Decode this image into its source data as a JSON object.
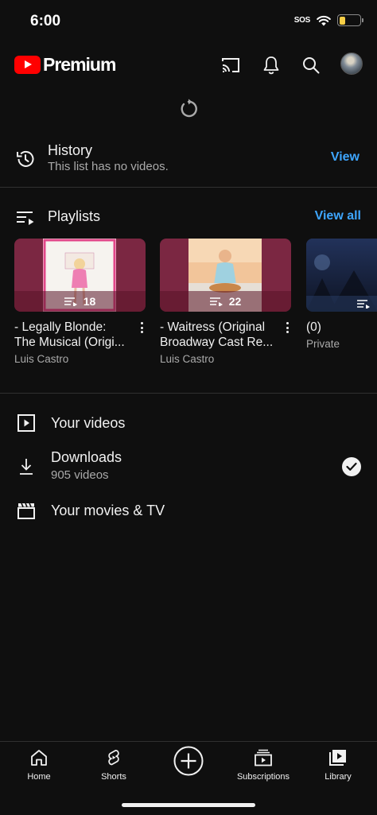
{
  "status_bar": {
    "time": "6:00",
    "sos": "SOS",
    "battery_level": 0.3
  },
  "app_bar": {
    "logo_text": "Premium",
    "icons": [
      "cast-icon",
      "bell-icon",
      "search-icon",
      "avatar"
    ]
  },
  "history": {
    "title": "History",
    "subtitle": "This list has no videos.",
    "action": "View"
  },
  "playlists": {
    "title": "Playlists",
    "action": "View all",
    "items": [
      {
        "line1": "- Legally Blonde:",
        "line2": "The Musical (Origi...",
        "owner": "Luis Castro",
        "count": "18"
      },
      {
        "line1": "- Waitress (Original",
        "line2": "Broadway Cast Re...",
        "owner": "Luis Castro",
        "count": "22"
      },
      {
        "line1": "(0)",
        "line2": "",
        "owner": "Private",
        "count": ""
      }
    ]
  },
  "library_items": {
    "your_videos": "Your videos",
    "downloads": "Downloads",
    "downloads_sub": "905 videos",
    "movies": "Your movies & TV"
  },
  "bottom_nav": {
    "home": "Home",
    "shorts": "Shorts",
    "create": "",
    "subscriptions": "Subscriptions",
    "library": "Library"
  },
  "colors": {
    "background": "#0f0f0f",
    "accent": "#3ea6ff",
    "brand": "#ff0000",
    "secondary_text": "#aaaaaa"
  }
}
